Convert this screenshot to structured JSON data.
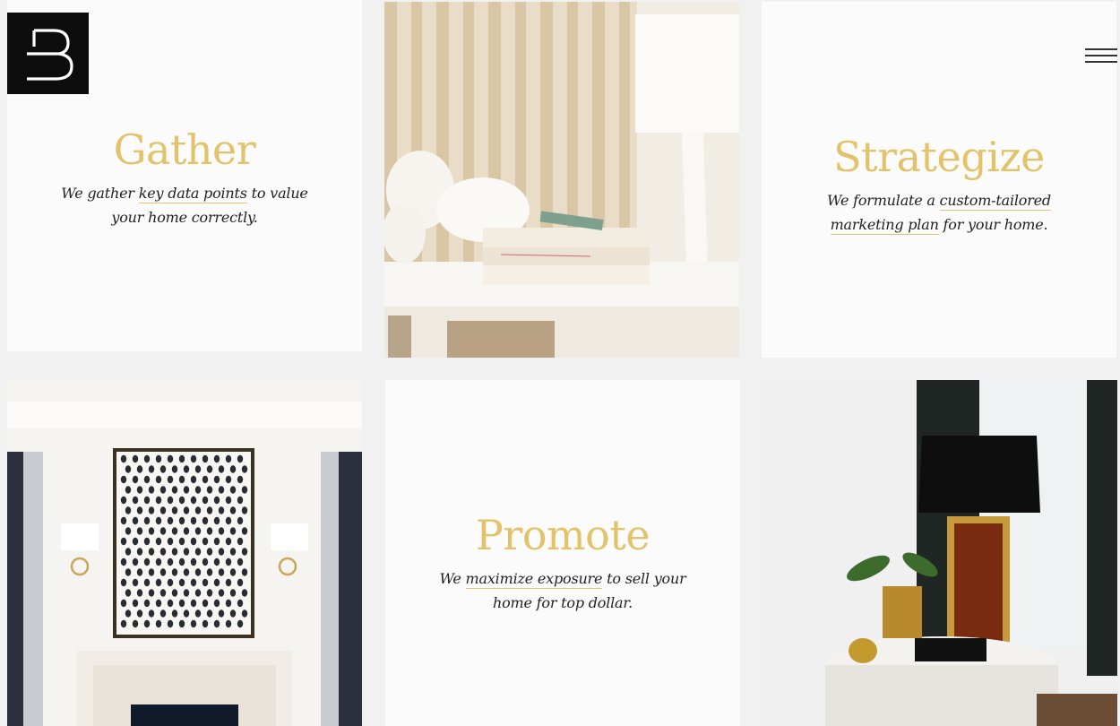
{
  "header": {
    "logo_letter": "B",
    "logo_icon": "b-monogram-logo",
    "menu_icon": "hamburger-menu-icon"
  },
  "tiles": {
    "gather": {
      "title": "Gather",
      "text_a": "We gather ",
      "link": "key data points",
      "text_b": " to value your home correctly."
    },
    "strategize": {
      "title": "Strategize",
      "text_a": "We formulate a ",
      "link": "custom-tailored marketing plan",
      "text_b": " for your home."
    },
    "promote": {
      "title": "Promote",
      "text_a": "We ",
      "link": "maximize exposure",
      "text_b": " to sell your home for top dollar."
    }
  },
  "colors": {
    "accent_gold": "#e3c36a",
    "tile_background": "#fbfbfc",
    "page_background": "#f1f1f1",
    "logo_background": "#0d0d0d"
  }
}
